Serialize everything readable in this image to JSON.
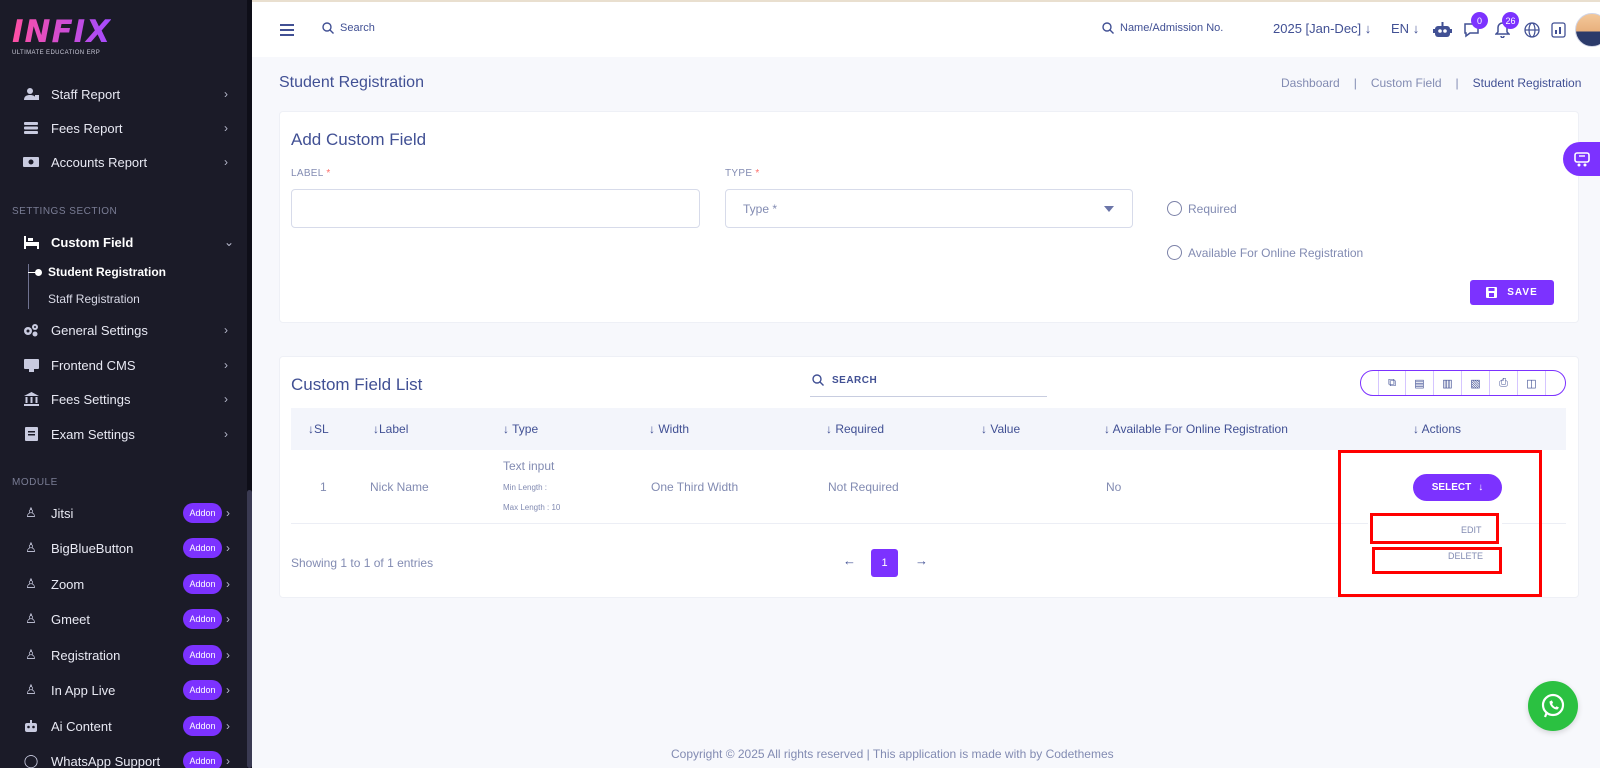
{
  "app": {
    "logo_text": "INFIX",
    "logo_subtitle": "ULTIMATE EDUCATION ERP"
  },
  "sidebar": {
    "reports": [
      {
        "label": "Staff Report",
        "icon": "user-chart-icon"
      },
      {
        "label": "Fees Report",
        "icon": "server-icon"
      },
      {
        "label": "Accounts Report",
        "icon": "money-icon"
      }
    ],
    "settings_title": "SETTINGS SECTION",
    "custom_field_label": "Custom Field",
    "custom_field_subitems": [
      "Student Registration",
      "Staff Registration"
    ],
    "settings": [
      {
        "label": "General Settings",
        "icon": "gears-icon"
      },
      {
        "label": "Frontend CMS",
        "icon": "monitor-icon"
      },
      {
        "label": "Fees Settings",
        "icon": "bank-icon"
      },
      {
        "label": "Exam Settings",
        "icon": "clipboard-icon"
      }
    ],
    "module_title": "MODULE",
    "modules": [
      {
        "label": "Jitsi",
        "badge": "Addon"
      },
      {
        "label": "BigBlueButton",
        "badge": "Addon"
      },
      {
        "label": "Zoom",
        "badge": "Addon"
      },
      {
        "label": "Gmeet",
        "badge": "Addon"
      },
      {
        "label": "Registration",
        "badge": "Addon"
      },
      {
        "label": "In App Live",
        "badge": "Addon"
      },
      {
        "label": "Ai Content",
        "badge": "Addon"
      },
      {
        "label": "WhatsApp Support",
        "badge": "Addon"
      }
    ]
  },
  "topbar": {
    "search_placeholder": "Search",
    "admission_search": "Name/Admission No.",
    "academic_year": "2025 [Jan-Dec]",
    "language": "EN",
    "chat_badge": "0",
    "notification_badge": "26"
  },
  "page": {
    "title": "Student Registration",
    "breadcrumb": [
      "Dashboard",
      "Custom Field",
      "Student Registration"
    ]
  },
  "form": {
    "title": "Add Custom Field",
    "label_field": "LABEL",
    "type_field": "TYPE",
    "required_star": "*",
    "type_placeholder": "Type *",
    "required_option": "Required",
    "online_option": "Available For Online Registration",
    "save_label": "SAVE"
  },
  "list": {
    "title": "Custom Field List",
    "search_label": "SEARCH",
    "columns": [
      "SL",
      "Label",
      "Type",
      "Width",
      "Required",
      "Value",
      "Available For Online Registration",
      "Actions"
    ],
    "rows": [
      {
        "sl": "1",
        "label": "Nick Name",
        "type": "Text input",
        "min_length": "Min Length :",
        "max_length": "Max Length : 10",
        "width": "One Third Width",
        "required": "Not Required",
        "value": "",
        "online": "No"
      }
    ],
    "select_label": "SELECT",
    "action_edit": "EDIT",
    "action_delete": "DELETE",
    "showing": "Showing 1 to 1 of 1 entries",
    "current_page": "1"
  },
  "footer": {
    "text": "Copyright © 2025 All rights reserved | This application is made with by Codethemes"
  },
  "colors": {
    "accent": "#7c32ff",
    "sidebar_bg": "#1b1b28",
    "text": "#415094",
    "muted": "#828bb2",
    "highlight": "#ff0000",
    "whatsapp": "#2bc141"
  }
}
